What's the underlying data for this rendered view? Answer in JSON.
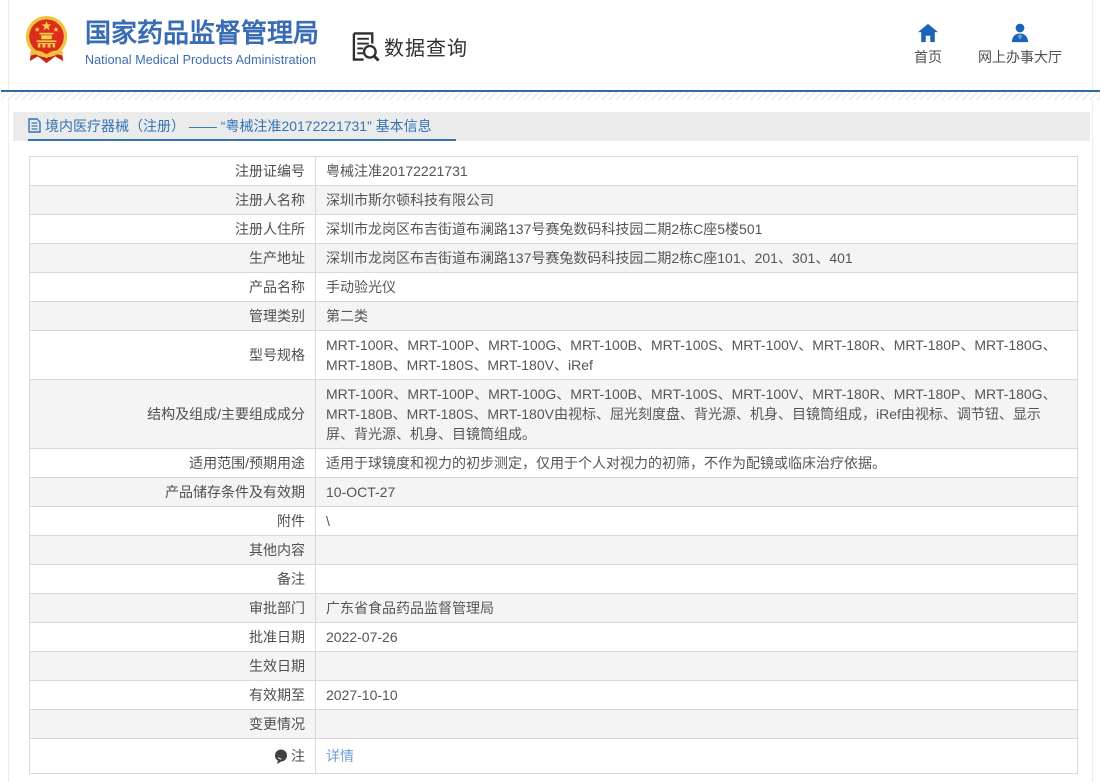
{
  "header": {
    "logo": {
      "title": "国家药品监督管理局",
      "subtitle": "National Medical Products Administration",
      "emblem_icon": "china-national-emblem",
      "title_color": "#3a6cb4"
    },
    "section": {
      "label": "数据查询",
      "icon": "document-search-icon"
    },
    "nav": [
      {
        "label": "首页",
        "icon": "home-icon"
      },
      {
        "label": "网上办事大厅",
        "icon": "person-icon"
      }
    ]
  },
  "breadcrumb": {
    "icon": "document-icon",
    "text": "境内医疗器械（注册） —— “粤械注准20172221731” 基本信息",
    "color": "#3173b5"
  },
  "table": {
    "rows": [
      {
        "label": "注册证编号",
        "value": "粤械注准20172221731"
      },
      {
        "label": "注册人名称",
        "value": "深圳市斯尔顿科技有限公司"
      },
      {
        "label": "注册人住所",
        "value": "深圳市龙岗区布吉街道布澜路137号赛兔数码科技园二期2栋C座5楼501"
      },
      {
        "label": "生产地址",
        "value": "深圳市龙岗区布吉街道布澜路137号赛兔数码科技园二期2栋C座101、201、301、401"
      },
      {
        "label": "产品名称",
        "value": "手动验光仪"
      },
      {
        "label": "管理类别",
        "value": "第二类"
      },
      {
        "label": "型号规格",
        "value": "MRT-100R、MRT-100P、MRT-100G、MRT-100B、MRT-100S、MRT-100V、MRT-180R、MRT-180P、MRT-180G、MRT-180B、MRT-180S、MRT-180V、iRef"
      },
      {
        "label": "结构及组成/主要组成成分",
        "value": "MRT-100R、MRT-100P、MRT-100G、MRT-100B、MRT-100S、MRT-100V、MRT-180R、MRT-180P、MRT-180G、MRT-180B、MRT-180S、MRT-180V由视标、屈光刻度盘、背光源、机身、目镜筒组成，iRef由视标、调节钮、显示屏、背光源、机身、目镜筒组成。"
      },
      {
        "label": "适用范围/预期用途",
        "value": "适用于球镜度和视力的初步测定，仅用于个人对视力的初筛，不作为配镜或临床治疗依据。"
      },
      {
        "label": "产品储存条件及有效期",
        "value": "10-OCT-27"
      },
      {
        "label": "附件",
        "value": "\\"
      },
      {
        "label": "其他内容",
        "value": ""
      },
      {
        "label": "备注",
        "value": ""
      },
      {
        "label": "审批部门",
        "value": "广东省食品药品监督管理局"
      },
      {
        "label": "批准日期",
        "value": "2022-07-26"
      },
      {
        "label": "生效日期",
        "value": ""
      },
      {
        "label": "有效期至",
        "value": "2027-10-10"
      },
      {
        "label": "变更情况",
        "value": ""
      },
      {
        "label": "注",
        "value": "详情",
        "icon": "note-bubble-icon",
        "value_is_link": true
      }
    ],
    "alt_row_color": "#f4f4f4",
    "link_color": "#6f9fd8"
  }
}
